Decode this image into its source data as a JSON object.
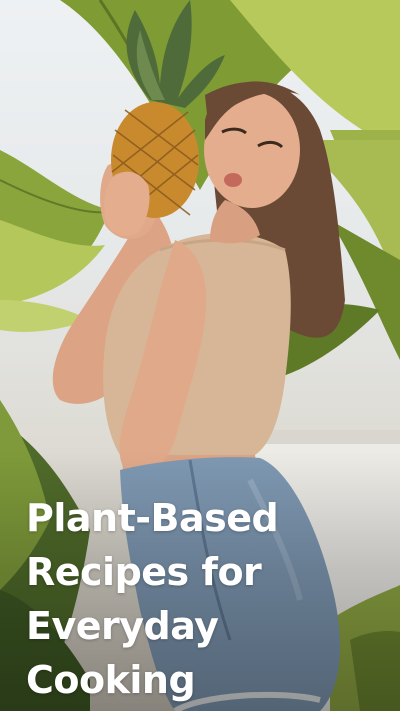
{
  "story": {
    "headline_lines": [
      "Plant-Based",
      "Recipes for",
      "Everyday",
      "Cooking"
    ]
  },
  "photo": {
    "subject": "woman-holding-pineapple",
    "colors": {
      "leaf_dark": "#5f7d2a",
      "leaf_light": "#a9bd4c",
      "sky": "#eef1f3",
      "wall": "#ece9e2",
      "top": "#d9b99b",
      "skin": "#e0a98a",
      "hair": "#6b4a35",
      "denim": "#7d97b2",
      "pineapple": "#c98a2e",
      "pineapple_crown": "#4f6b3a"
    }
  }
}
